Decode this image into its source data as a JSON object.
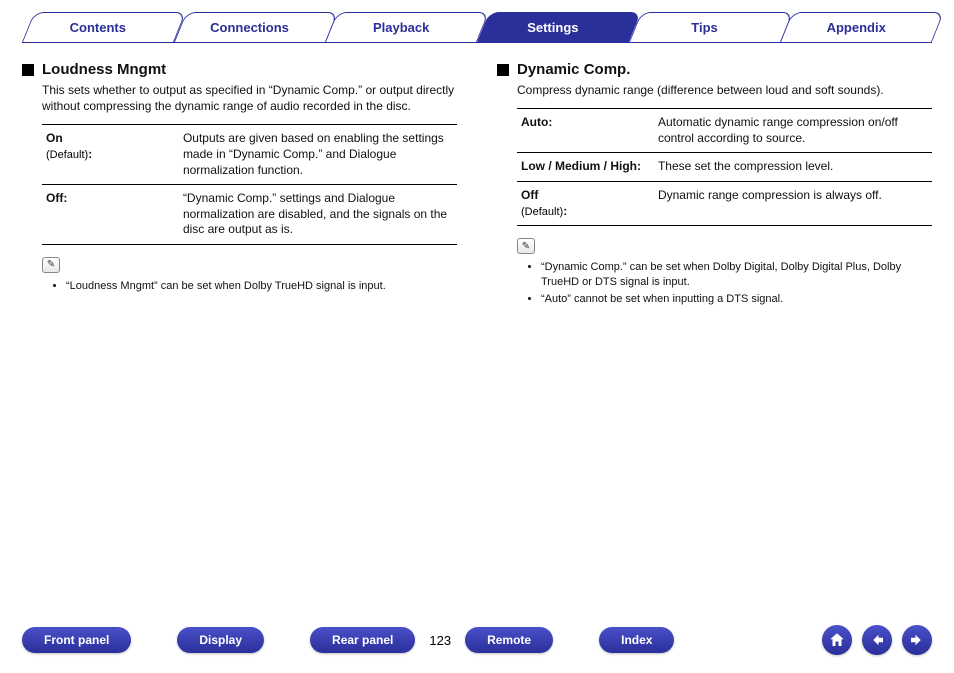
{
  "tabs": {
    "contents": "Contents",
    "connections": "Connections",
    "playback": "Playback",
    "settings": "Settings",
    "tips": "Tips",
    "appendix": "Appendix",
    "active": "settings"
  },
  "left": {
    "title": "Loudness Mngmt",
    "intro": "This sets whether to output as specified in “Dynamic Comp.” or output directly without compressing the dynamic range of audio recorded in the disc.",
    "rows": [
      {
        "key": "On",
        "default": "(Default)",
        "colon": ":",
        "desc": "Outputs are given based on enabling the settings made in “Dynamic Comp.” and Dialogue normalization function."
      },
      {
        "key": "Off:",
        "default": "",
        "colon": "",
        "desc": "“Dynamic Comp.” settings and Dialogue normalization are disabled, and the signals on the disc are output as is."
      }
    ],
    "notes": [
      "“Loudness Mngmt” can be set when Dolby TrueHD signal is input."
    ]
  },
  "right": {
    "title": "Dynamic Comp.",
    "intro": "Compress dynamic range (difference between loud and soft sounds).",
    "rows": [
      {
        "key": "Auto:",
        "default": "",
        "colon": "",
        "desc": "Automatic dynamic range compression on/off control according to source."
      },
      {
        "key": "Low / Medium / High:",
        "default": "",
        "colon": "",
        "desc": "These set the compression level."
      },
      {
        "key": "Off",
        "default": "(Default)",
        "colon": ":",
        "desc": "Dynamic range compression is always off."
      }
    ],
    "notes": [
      "“Dynamic Comp.” can be set when Dolby Digital, Dolby Digital Plus, Dolby TrueHD or DTS signal is input.",
      "“Auto” cannot be set when inputting a DTS signal."
    ]
  },
  "footer": {
    "front": "Front panel",
    "display": "Display",
    "rear": "Rear panel",
    "page": "123",
    "remote": "Remote",
    "index": "Index"
  },
  "noteIcon": "✎"
}
